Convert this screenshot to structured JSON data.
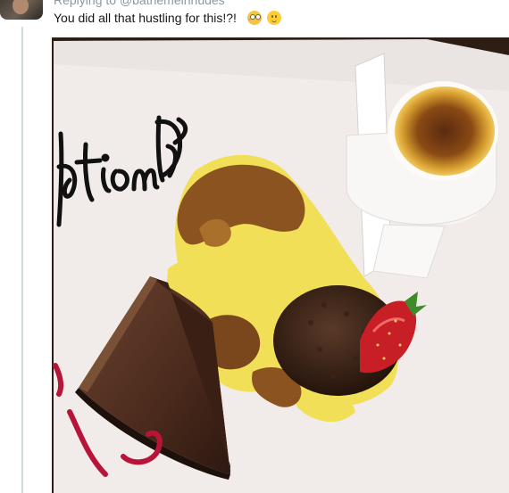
{
  "tweet": {
    "replying_prefix": "Replying to",
    "replying_handle": "@bathemeinnudes",
    "text": "You did all that hustling for this!?!",
    "emojis": [
      "flushed-face-emoji",
      "smiling-face-emoji"
    ]
  },
  "media": {
    "plate_writing": "ationD"
  },
  "colors": {
    "secondary_text": "#8899a6",
    "primary_text": "#14171a",
    "thread_line": "#cfd9de",
    "table_background": "#2e1d15"
  }
}
